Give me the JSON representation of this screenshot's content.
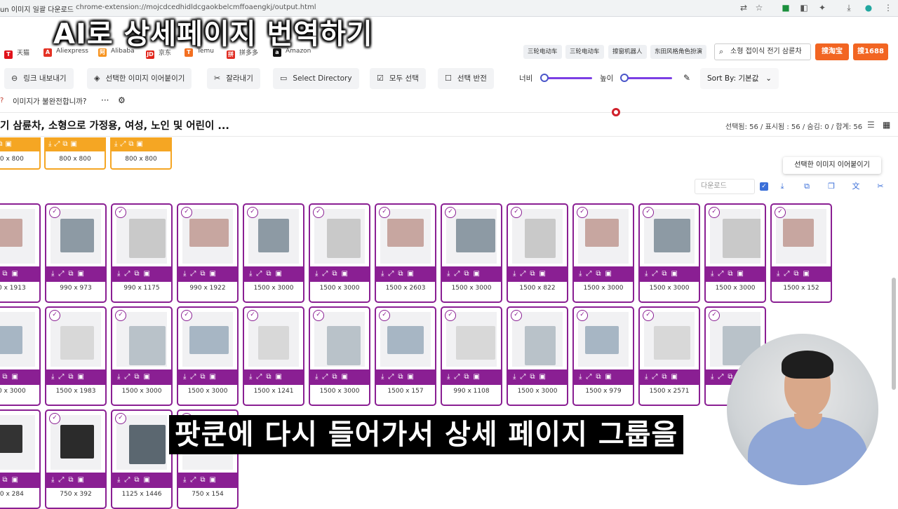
{
  "browser": {
    "tab_title": "un 이미지 일괄 다운로드",
    "address": "chrome-extension://mojcdcedhidldcgaokbelcmffoaengkj/output.html"
  },
  "overlay_title": "AI로 상세페이지 번역하기",
  "bookmarks": [
    {
      "label": "天猫",
      "icon_color": "#e0121b",
      "icon_text": "T"
    },
    {
      "label": "Aliexpress",
      "icon_color": "#e43225",
      "icon_text": "A"
    },
    {
      "label": "Alibaba",
      "icon_color": "#f7931e",
      "icon_text": "阿"
    },
    {
      "label": "京东",
      "icon_color": "#e1251b",
      "icon_text": "JD"
    },
    {
      "label": "Temu",
      "icon_color": "#f36f21",
      "icon_text": "T"
    },
    {
      "label": "拼多多",
      "icon_color": "#e02e24",
      "icon_text": "拼"
    },
    {
      "label": "Amazon",
      "icon_color": "#111111",
      "icon_text": "a"
    }
  ],
  "tags": [
    "三轮电动车",
    "三轮电动车",
    "擦窗机器人",
    "东田风格角色扮演"
  ],
  "search": {
    "value": "소형 접이식 전기 삼륜차"
  },
  "buttons": {
    "taobao": "搜淘宝",
    "search1688": "搜1688"
  },
  "toolbar": {
    "export_links": "링크 내보내기",
    "stitch_selected": "선택한 이미지 이어붙이기",
    "crop": "잘라내기",
    "select_directory": "Select Directory",
    "select_all": "모두 선택",
    "invert_selection": "선택 반전",
    "width_label": "너비",
    "height_label": "높이",
    "sort_label": "Sort By: 기본값",
    "more": "···"
  },
  "incomplete_prompt": "이미지가 불완전합니까?",
  "product_title": "기 삼륜차, 소형으로 가정용, 여성, 노인 및 어린이 ...",
  "stats": "선택됨: 56 / 표시됨 : 56 / 숨김: 0 / 합계: 56",
  "tooltip": "선택한 이미지 이어붙이기",
  "download_placeholder": "다운로드",
  "top_cards": [
    "00 x 800",
    "800 x 800",
    "800 x 800"
  ],
  "rows": [
    [
      "00 x 1913",
      "990 x 973",
      "990 x 1175",
      "990 x 1922",
      "1500 x 3000",
      "1500 x 3000",
      "1500 x 2603",
      "1500 x 3000",
      "1500 x 822",
      "1500 x 3000",
      "1500 x 3000",
      "1500 x 3000",
      "1500 x 152"
    ],
    [
      "00 x 3000",
      "1500 x 1983",
      "1500 x 3000",
      "1500 x 3000",
      "1500 x 1241",
      "1500 x 3000",
      "1500 x 157",
      "990 x 1108",
      "1500 x 3000",
      "1500 x 979",
      "1500 x 2571",
      "150",
      ""
    ],
    [
      "00 x 284",
      "750 x 392",
      "1125 x 1446",
      "750 x 154"
    ]
  ],
  "subtitle": "팟쿤에 다시 들어가서 상세 페이지 그룹을",
  "colors": {
    "accent_purple": "#8a1f93",
    "accent_orange": "#f5a623",
    "brand_orange": "#f26522",
    "link_blue": "#3b6fd8"
  }
}
